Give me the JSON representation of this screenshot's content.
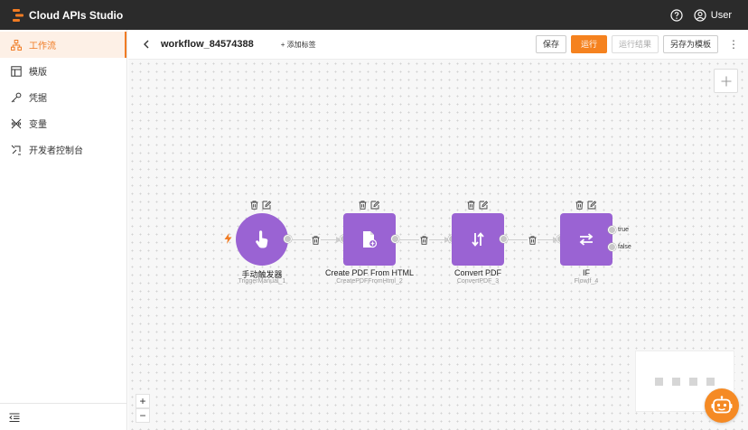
{
  "app": {
    "title": "Cloud APIs Studio",
    "user_label": "User",
    "brand_color": "#f07b23"
  },
  "sidebar": {
    "items": [
      {
        "label": "工作流",
        "icon": "workflow-icon",
        "active": true
      },
      {
        "label": "模版",
        "icon": "template-icon",
        "active": false
      },
      {
        "label": "凭据",
        "icon": "key-icon",
        "active": false
      },
      {
        "label": "变量",
        "icon": "variable-icon",
        "active": false
      },
      {
        "label": "开发者控制台",
        "icon": "developer-console-icon",
        "active": false
      }
    ]
  },
  "toolbar": {
    "workflow_name": "workflow_84574388",
    "add_tag": "+ 添加标签",
    "save": "保存",
    "run": "运行",
    "run_result": "运行结果",
    "save_as_template": "另存为模板"
  },
  "nodes": [
    {
      "title": "手动触发器",
      "subtitle": "TriggerManual_1",
      "icon": "hand-pointer-icon"
    },
    {
      "title": "Create PDF From HTML",
      "subtitle": "CreatePDFFromHtml_2",
      "icon": "pdf-file-icon"
    },
    {
      "title": "Convert PDF",
      "subtitle": "ConvertPDF_3",
      "icon": "convert-icon"
    },
    {
      "title": "IF",
      "subtitle": "FlowIf_4",
      "icon": "swap-arrows-icon"
    }
  ],
  "branches": {
    "true_label": "true",
    "false_label": "false"
  },
  "zoom": {
    "in": "+",
    "out": "−"
  }
}
